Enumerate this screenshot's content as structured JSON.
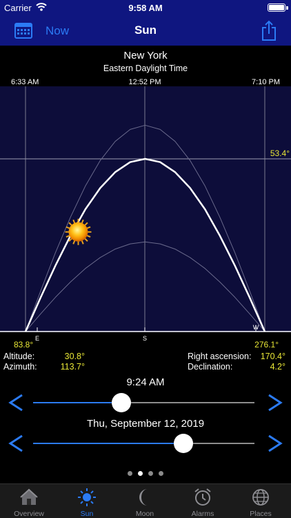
{
  "status_bar": {
    "carrier": "Carrier",
    "time": "9:58 AM"
  },
  "navbar": {
    "now_label": "Now",
    "title": "Sun",
    "calendar_icon": "calendar-icon",
    "share_icon": "share-icon"
  },
  "location": {
    "city": "New York",
    "timezone": "Eastern Daylight Time"
  },
  "chart_data": {
    "type": "line",
    "time_labels": {
      "rise": "6:33 AM",
      "noon": "12:52 PM",
      "set": "7:10 PM"
    },
    "max_altitude_label": "53.4°",
    "rise_azimuth_label": "83.8°",
    "set_azimuth_label": "276.1°",
    "direction_ticks": [
      "E",
      "S",
      "W"
    ],
    "x": [
      0,
      0.0625,
      0.125,
      0.1875,
      0.25,
      0.3125,
      0.375,
      0.4375,
      0.5,
      0.5625,
      0.625,
      0.6875,
      0.75,
      0.8125,
      0.875,
      0.9375,
      1
    ],
    "series": [
      {
        "values": [
          0,
          10.4,
          20.4,
          29.6,
          37.8,
          44.4,
          49.3,
          52.4,
          53.4,
          52.4,
          49.3,
          44.4,
          37.8,
          29.6,
          20.4,
          10.4,
          0
        ]
      },
      {
        "values": [
          0,
          12.4,
          24.4,
          35.3,
          45.0,
          52.9,
          58.8,
          62.5,
          63.8,
          62.5,
          58.8,
          52.9,
          45.0,
          35.3,
          24.4,
          12.4,
          0
        ]
      },
      {
        "values": [
          0,
          5.4,
          10.6,
          15.3,
          19.5,
          22.9,
          25.5,
          27.1,
          27.7,
          27.1,
          25.5,
          22.9,
          19.5,
          15.3,
          10.6,
          5.4,
          0
        ]
      }
    ],
    "current": {
      "x": 0.2205,
      "altitude": 30.8
    },
    "ylim": [
      0,
      70
    ]
  },
  "readouts": {
    "altitude_label": "Altitude:",
    "altitude_value": "30.8°",
    "azimuth_label": "Azimuth:",
    "azimuth_value": "113.7°",
    "ra_label": "Right ascension:",
    "ra_value": "170.4°",
    "dec_label": "Declination:",
    "dec_value": "4.2°"
  },
  "time_slider": {
    "label": "9:24 AM",
    "value": 0.4
  },
  "date_slider": {
    "label": "Thu, September 12, 2019",
    "value": 0.68
  },
  "page_dots": {
    "count": 4,
    "active": 1
  },
  "tabs": [
    {
      "label": "Overview",
      "icon": "house-icon"
    },
    {
      "label": "Sun",
      "icon": "sun-icon"
    },
    {
      "label": "Moon",
      "icon": "moon-icon"
    },
    {
      "label": "Alarms",
      "icon": "alarm-clock-icon"
    },
    {
      "label": "Places",
      "icon": "globe-icon"
    }
  ],
  "colors": {
    "bar": "#0f1680",
    "chart_bg": "#0d0d3a",
    "accent": "#2b7bf5",
    "value": "#e8e636"
  }
}
